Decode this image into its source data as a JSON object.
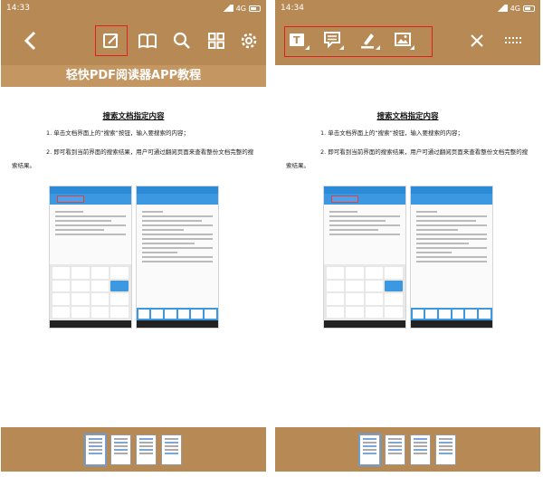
{
  "left": {
    "time": "14:33",
    "network": "4G",
    "title": "轻快PDF阅读器APP教程",
    "toolbar_icons": [
      "back-arrow-icon",
      "edit-icon",
      "book-icon",
      "search-icon",
      "grid-icon",
      "gear-icon"
    ]
  },
  "right": {
    "time": "14:34",
    "network": "4G",
    "toolbar_icons": [
      "text-tool-icon",
      "comment-tool-icon",
      "highlighter-tool-icon",
      "image-tool-icon",
      "close-icon",
      "more-icon"
    ]
  },
  "document": {
    "heading": "搜索文档指定内容",
    "step1": "1. 单击文档界面上的“搜索”按钮，输入要搜索的内容；",
    "step2": "2. 即可看到当前界面的搜索结果，用户可通过翻阅页面来查看整份文档完整的搜索结果。"
  },
  "thumbnail_count": 4,
  "colors": {
    "toolbar": "#b78a55",
    "titlebar": "#c49662",
    "highlight": "#e02020"
  }
}
